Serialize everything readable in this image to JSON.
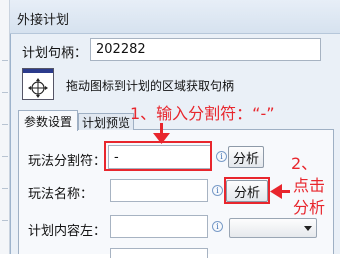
{
  "dialog": {
    "title": "外接计划"
  },
  "handle": {
    "label": "计划句柄：",
    "value": "202282"
  },
  "drag_hint": "拖动图标到计划的区域获取句柄",
  "tabs": [
    {
      "label": "参数设置",
      "active": true
    },
    {
      "label": "计划预览",
      "active": false
    }
  ],
  "fields": {
    "separator": {
      "label": "玩法分割符：",
      "value": "-",
      "button": "分析"
    },
    "name": {
      "label": "玩法名称：",
      "value": "",
      "button": "分析"
    },
    "content_left": {
      "label": "计划内容左：",
      "value": ""
    }
  },
  "annotations": {
    "step1": "1、输入分割符：“-”",
    "step2_line1": "2、",
    "step2_line2": "点击",
    "step2_line3": "分析"
  },
  "colors": {
    "annotation": "#e8262d",
    "dialog_bg": "#eaf0f7"
  },
  "icons": {
    "info": "info-icon",
    "target": "crosshair-icon"
  }
}
